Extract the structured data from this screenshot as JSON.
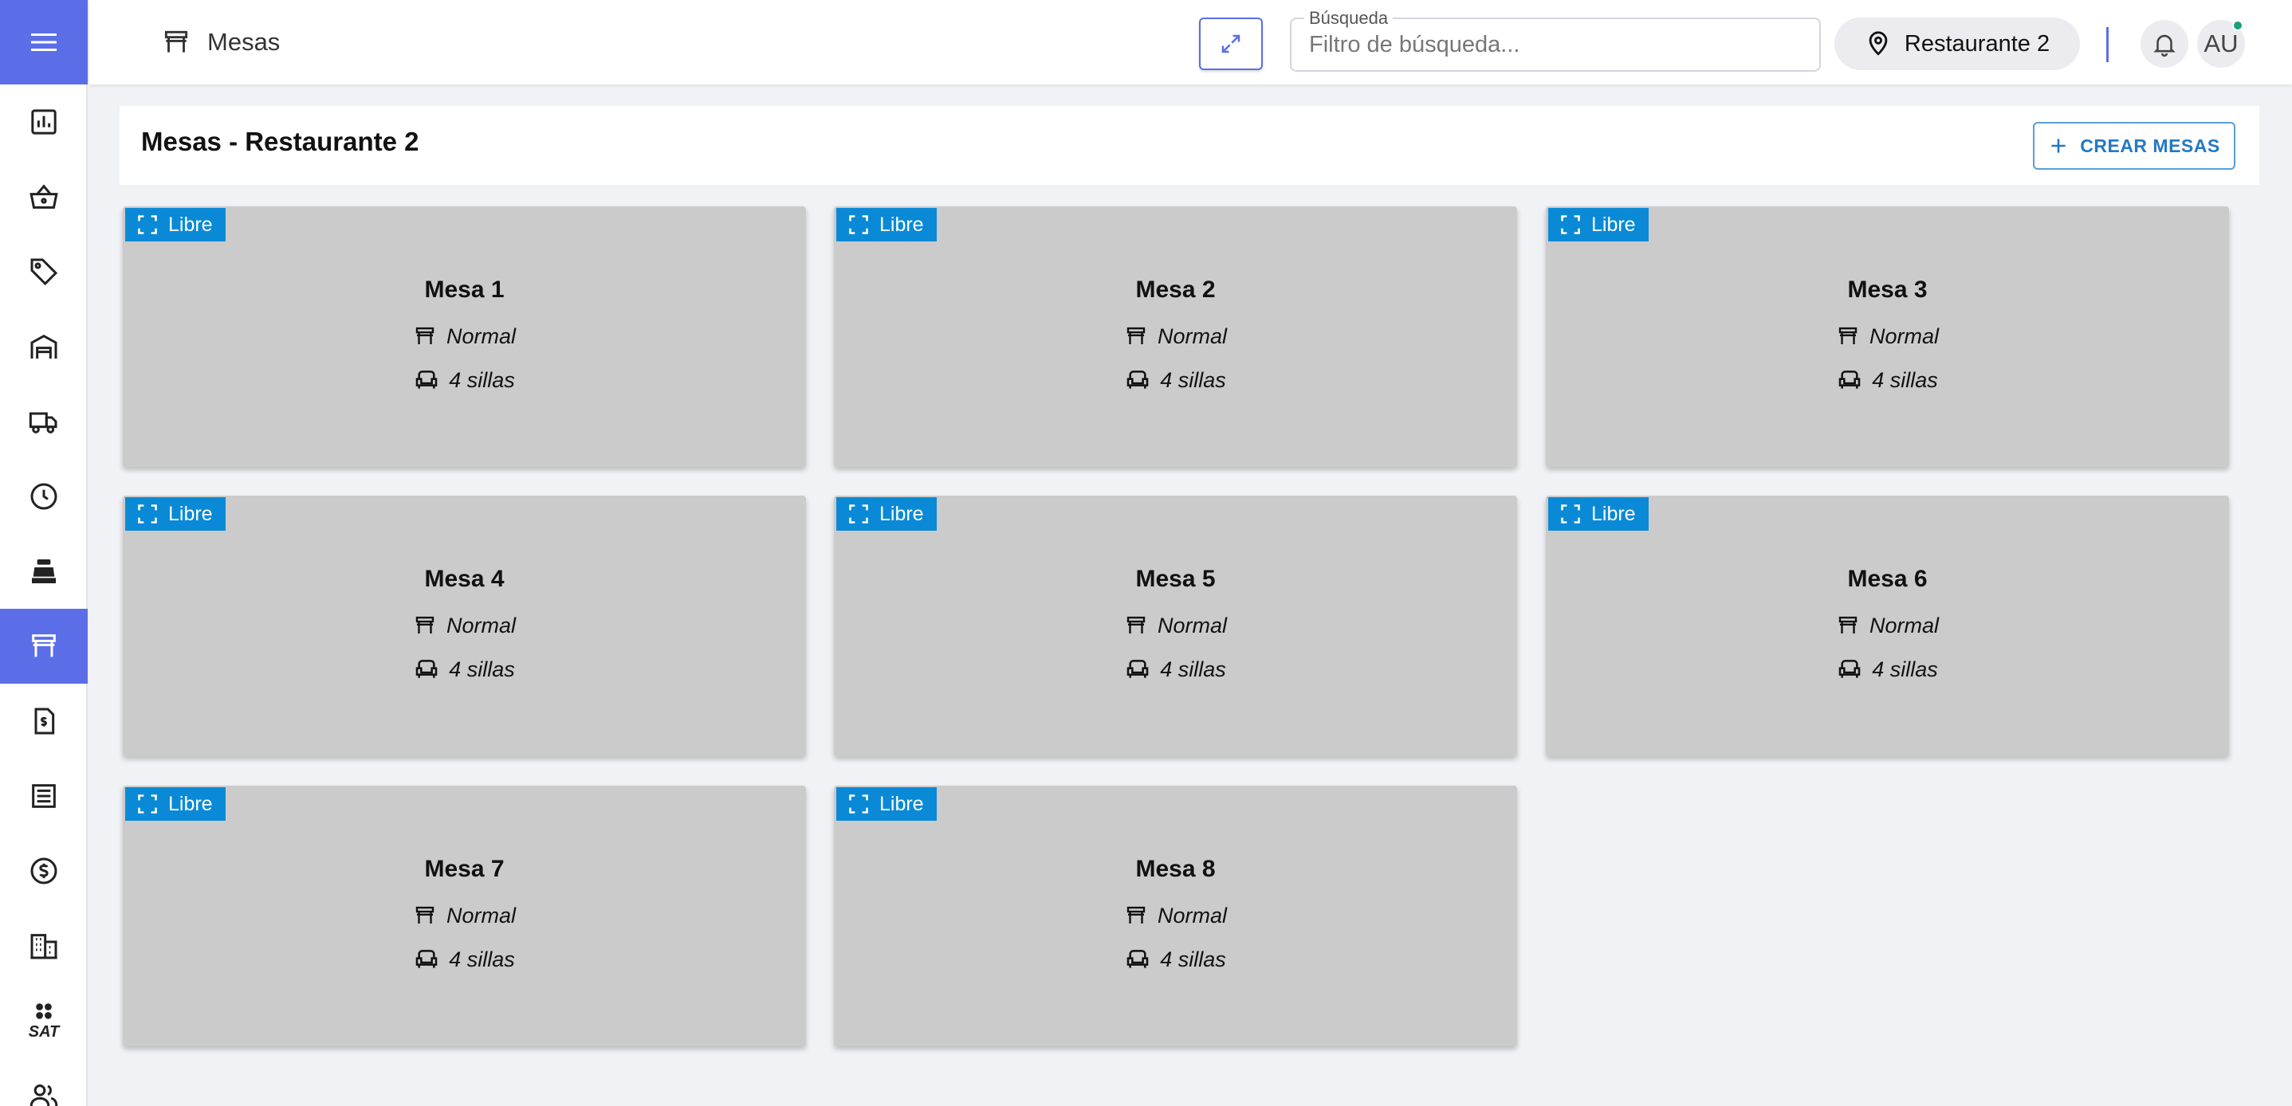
{
  "header": {
    "breadcrumb": "Mesas",
    "search": {
      "label": "Búsqueda",
      "placeholder": "Filtro de búsqueda..."
    },
    "location": "Restaurante 2",
    "user_initials": "AU"
  },
  "sidebar": {
    "items": [
      {
        "name": "dashboard",
        "icon": "bar-chart-icon"
      },
      {
        "name": "sales",
        "icon": "basket-icon"
      },
      {
        "name": "products",
        "icon": "tag-icon"
      },
      {
        "name": "warehouse",
        "icon": "warehouse-icon"
      },
      {
        "name": "delivery",
        "icon": "truck-icon"
      },
      {
        "name": "history",
        "icon": "clock-icon"
      },
      {
        "name": "cash-register",
        "icon": "register-icon"
      },
      {
        "name": "tables",
        "icon": "table-icon",
        "active": true
      },
      {
        "name": "invoices",
        "icon": "invoice-icon"
      },
      {
        "name": "receipts",
        "icon": "receipt-icon"
      },
      {
        "name": "payments",
        "icon": "dollar-icon"
      },
      {
        "name": "companies",
        "icon": "building-icon"
      },
      {
        "name": "sat",
        "icon": "sat-icon",
        "label": "SAT"
      },
      {
        "name": "users",
        "icon": "users-icon"
      }
    ]
  },
  "main": {
    "title": "Mesas - Restaurante 2",
    "create_button": "CREAR MESAS",
    "tables": [
      {
        "status": "Libre",
        "name": "Mesa 1",
        "type": "Normal",
        "chairs": "4 sillas"
      },
      {
        "status": "Libre",
        "name": "Mesa 2",
        "type": "Normal",
        "chairs": "4 sillas"
      },
      {
        "status": "Libre",
        "name": "Mesa 3",
        "type": "Normal",
        "chairs": "4 sillas"
      },
      {
        "status": "Libre",
        "name": "Mesa 4",
        "type": "Normal",
        "chairs": "4 sillas"
      },
      {
        "status": "Libre",
        "name": "Mesa 5",
        "type": "Normal",
        "chairs": "4 sillas"
      },
      {
        "status": "Libre",
        "name": "Mesa 6",
        "type": "Normal",
        "chairs": "4 sillas"
      },
      {
        "status": "Libre",
        "name": "Mesa 7",
        "type": "Normal",
        "chairs": "4 sillas"
      },
      {
        "status": "Libre",
        "name": "Mesa 8",
        "type": "Normal",
        "chairs": "4 sillas"
      }
    ]
  },
  "colors": {
    "accent": "#5b6ee8",
    "status_free": "#0a8ad6",
    "card_bg": "#cbcbcb",
    "create_button": "#2479c2",
    "online_dot": "#1aa37a"
  }
}
